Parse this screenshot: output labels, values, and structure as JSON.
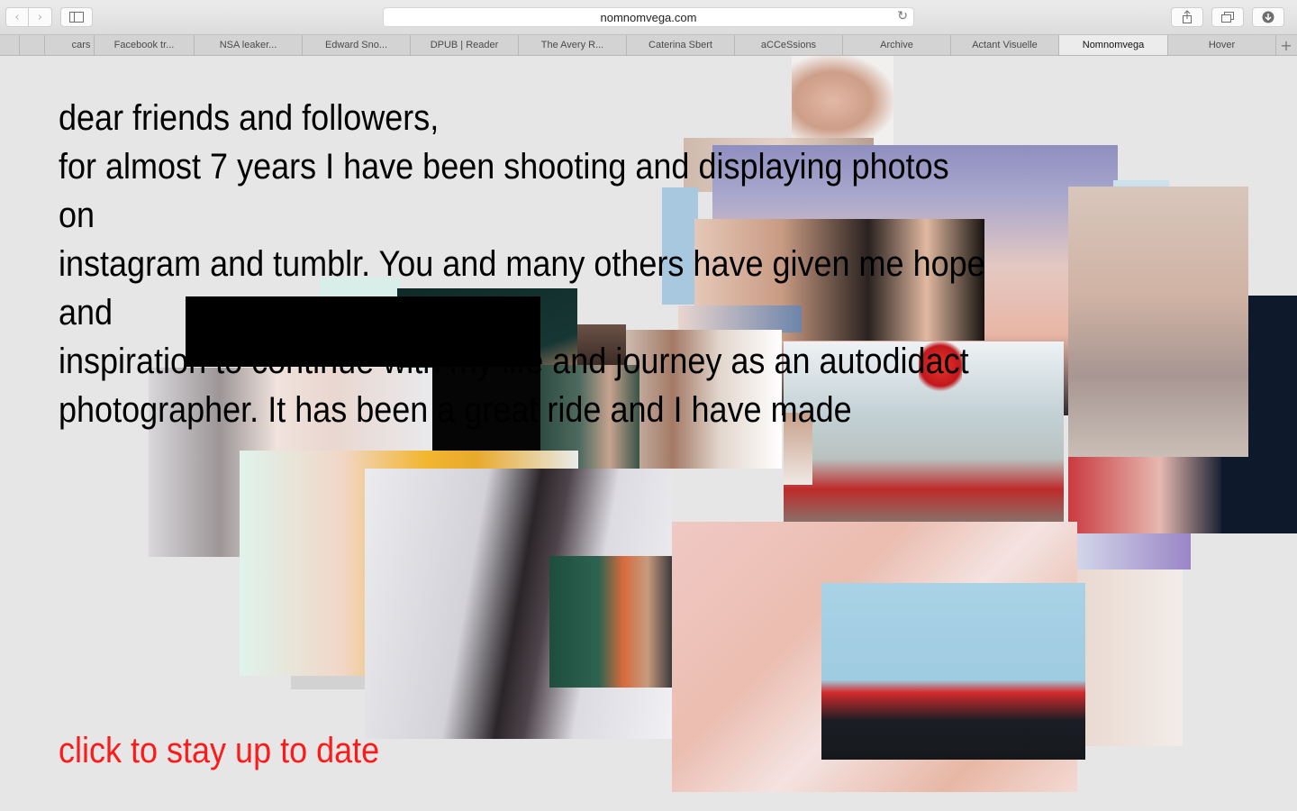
{
  "browser": {
    "url": "nomnomvega.com",
    "nav_back_icon": "chevron-left-icon",
    "nav_forward_icon": "chevron-right-icon",
    "tabs": [
      "cars",
      "Facebook tr...",
      "NSA leaker...",
      "Edward Sno...",
      "DPUB | Reader",
      "The Avery R...",
      "Caterina Sbert",
      "aCCeSsions",
      "Archive",
      "Actant Visuelle",
      "Nomnomvega",
      "Hover"
    ],
    "active_tab": "Nomnomvega",
    "new_tab": "+"
  },
  "page": {
    "letter_lines": [
      "dear friends and followers,",
      "for almost 7 years I have been shooting and displaying photos on",
      "instagram and tumblr. You and many others have given me hope and",
      "inspiration to continue with my life and journey as an autodidact",
      "photographer. It has been a great ride and I have made"
    ],
    "cta_link": "click to stay up to date"
  },
  "colors": {
    "page_background": "#e6e6e6",
    "cta": "#ff1a1a",
    "text": "#000000"
  }
}
